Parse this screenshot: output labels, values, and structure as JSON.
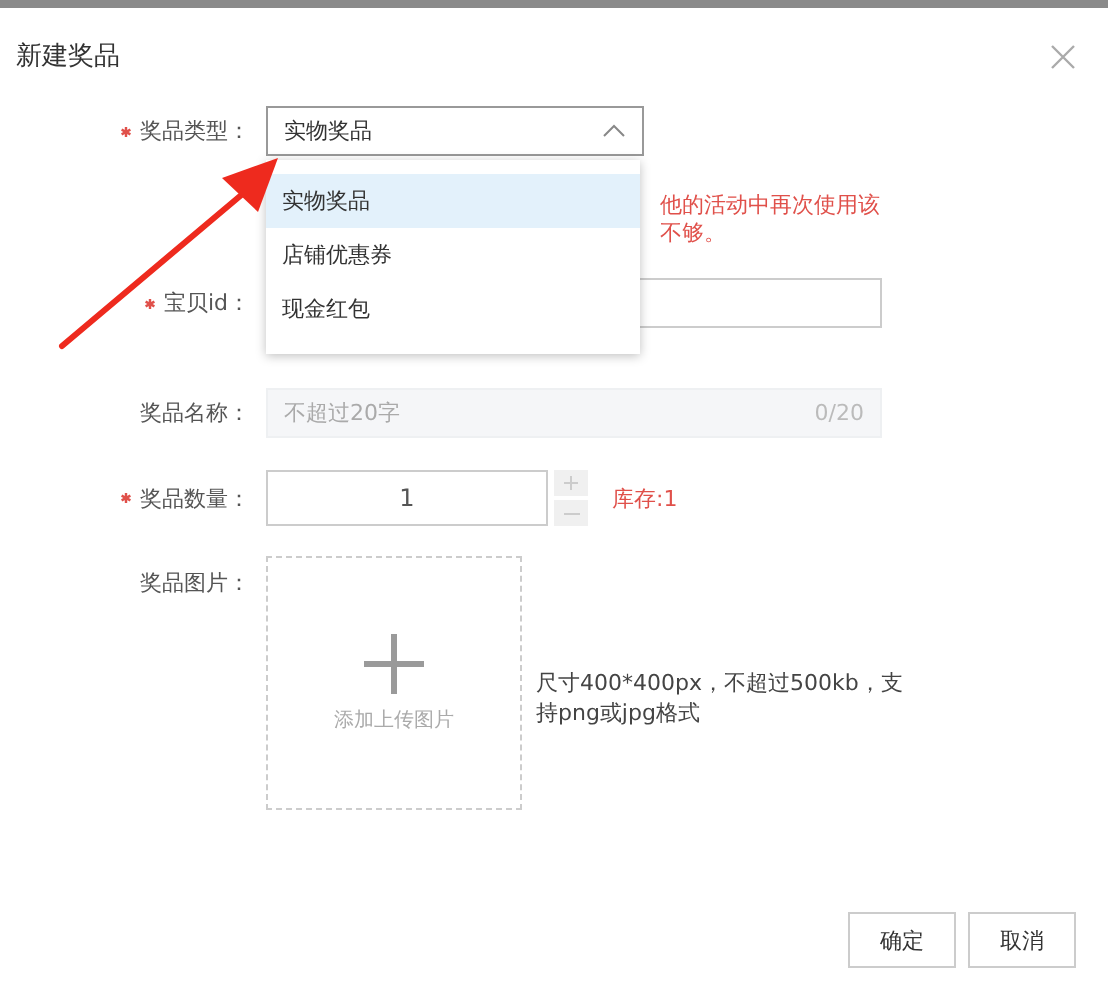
{
  "dialog": {
    "title": "新建奖品"
  },
  "fields": [
    {
      "kind": "select",
      "label": "奖品类型：",
      "required": true,
      "value": "实物奖品",
      "expanded": true,
      "options": [
        {
          "label": "实物奖品",
          "selected": true
        },
        {
          "label": "店铺优惠券",
          "selected": false
        },
        {
          "label": "现金红包",
          "selected": false
        }
      ],
      "hint": [
        "他的活动中再次使用该",
        "不够。"
      ]
    },
    {
      "kind": "text",
      "label": "宝贝id：",
      "required": true
    },
    {
      "kind": "text",
      "label": "奖品名称：",
      "required": false,
      "placeholder": "不超过20字",
      "counter": "0/20",
      "disabled": true
    },
    {
      "kind": "number",
      "label": "奖品数量：",
      "required": true,
      "value": "1",
      "note": "库存:1"
    },
    {
      "kind": "upload",
      "label": "奖品图片：",
      "required": false,
      "prompt": "添加上传图片",
      "note": "尺寸400*400px，不超过500kb，支持png或jpg格式"
    }
  ],
  "buttons": [
    {
      "label": "确定"
    },
    {
      "label": "取消"
    }
  ]
}
